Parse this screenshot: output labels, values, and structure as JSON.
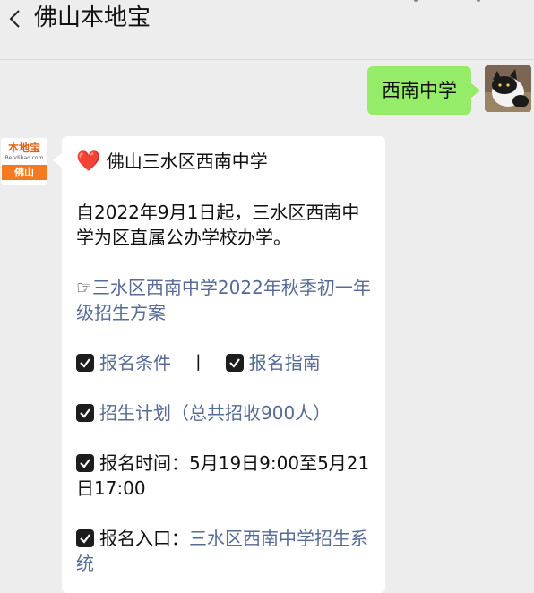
{
  "header": {
    "title": "佛山本地宝"
  },
  "outgoing": {
    "text": "西南中学"
  },
  "bot_avatar": {
    "logo_text": "本地宝",
    "url_text": "Bendibao.com",
    "city": "佛山"
  },
  "message": {
    "heading_emoji": "❤️",
    "heading": "佛山三水区西南中学",
    "intro": "自2022年9月1日起，三水区西南中学为区直属公办学校办学。",
    "pointer": "☞",
    "plan_link": "三水区西南中学2022年秋季初一年级招生方案",
    "conditions_link": "报名条件",
    "separator": "丨",
    "guide_link": "报名指南",
    "enroll_plan_link": "招生计划（总共招收900人）",
    "time_label": "报名时间：",
    "time_value": "5月19日9:00至5月21日17:00",
    "entry_label": "报名入口：",
    "entry_link": "三水区西南中学招生系统"
  }
}
